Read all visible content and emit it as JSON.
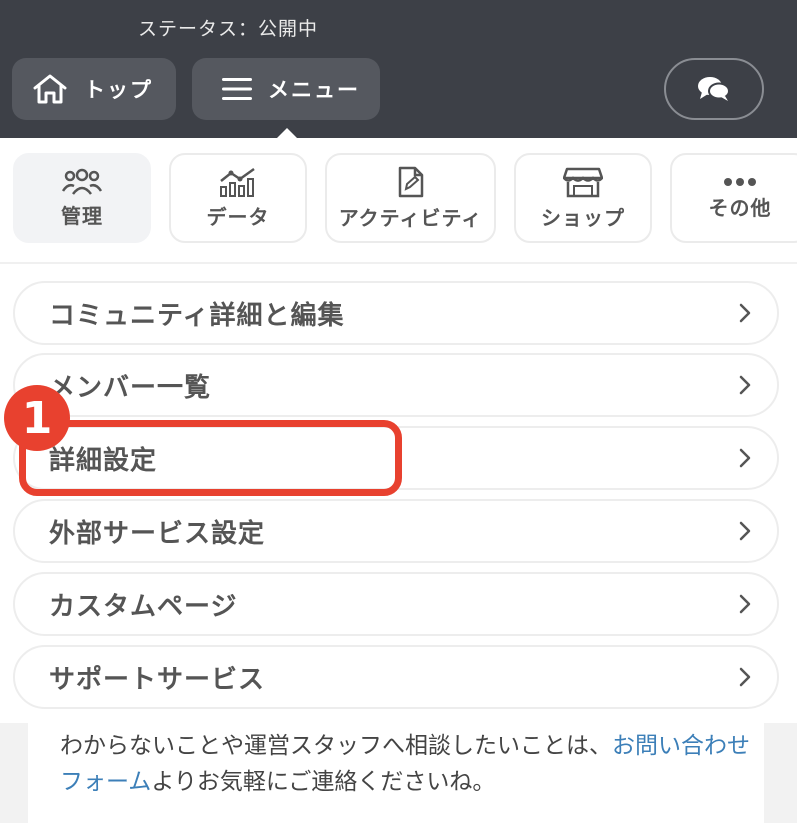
{
  "header": {
    "status": "ステータス：公開中",
    "top_label": "トップ",
    "menu_label": "メニュー"
  },
  "tabs": [
    {
      "label": "管理",
      "icon": "people-icon",
      "active": true
    },
    {
      "label": "データ",
      "icon": "chart-icon",
      "active": false
    },
    {
      "label": "アクティビティ",
      "icon": "document-edit-icon",
      "active": false
    },
    {
      "label": "ショップ",
      "icon": "store-icon",
      "active": false
    },
    {
      "label": "その他",
      "icon": "more-icon",
      "active": false
    }
  ],
  "menu_items": [
    {
      "label": "コミュニティ詳細と編集"
    },
    {
      "label": "メンバー一覧"
    },
    {
      "label": "詳細設定"
    },
    {
      "label": "外部サービス設定"
    },
    {
      "label": "カスタムページ"
    },
    {
      "label": "サポートサービス"
    }
  ],
  "annotation": {
    "badge": "1",
    "color": "#e8412f"
  },
  "info": {
    "text_before": "わからないことや運営スタッフへ相談したいことは、",
    "link": "お問い合わせフォーム",
    "text_after": "よりお気軽にご連絡くださいね。"
  },
  "colors": {
    "header_bg": "#3d4047",
    "link": "#3c7fb8",
    "highlight": "#e8412f"
  }
}
